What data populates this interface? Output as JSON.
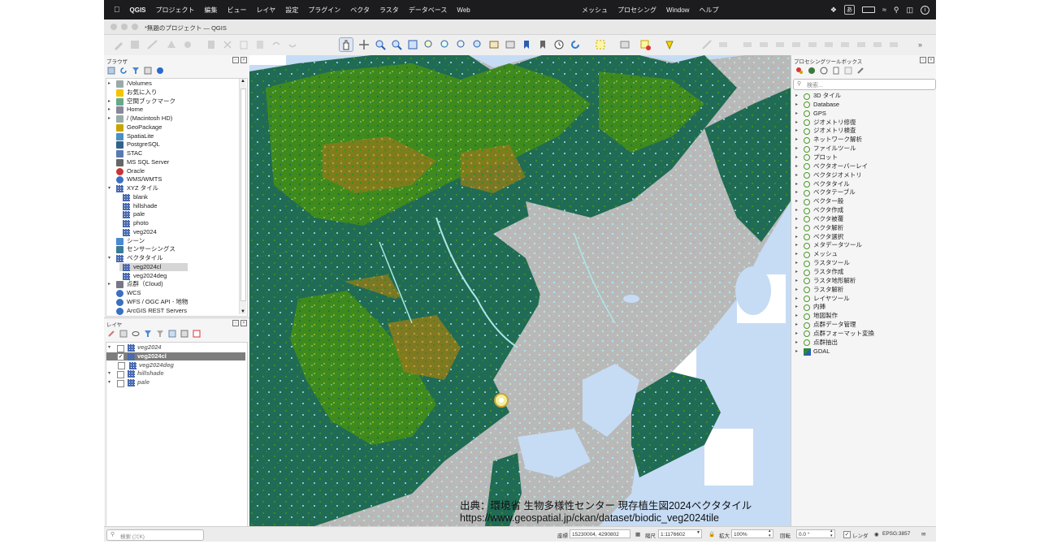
{
  "menubar": {
    "app_name": "QGIS",
    "items": [
      "プロジェクト",
      "編集",
      "ビュー",
      "レイヤ",
      "設定",
      "プラグイン",
      "ベクタ",
      "ラスタ",
      "データベース",
      "Web"
    ],
    "right_items": [
      "メッシュ",
      "プロセシング",
      "Window",
      "ヘルプ"
    ],
    "input_indicator": "あ"
  },
  "window": {
    "title": "*無題のプロジェクト — QGIS"
  },
  "browser": {
    "title": "ブラウザ",
    "items": [
      {
        "label": "/Volumes",
        "icon": "folder-icon",
        "level": 0,
        "arrow": "▸"
      },
      {
        "label": "お気に入り",
        "icon": "star-icon",
        "level": 0,
        "arrow": ""
      },
      {
        "label": "空間ブックマーク",
        "icon": "bookmark-icon",
        "level": 0,
        "arrow": "▸"
      },
      {
        "label": "Home",
        "icon": "home-icon",
        "level": 0,
        "arrow": "▸"
      },
      {
        "label": "/ (Macintosh HD)",
        "icon": "folder-icon",
        "level": 0,
        "arrow": "▸"
      },
      {
        "label": "GeoPackage",
        "icon": "geopackage-icon",
        "level": 0,
        "arrow": ""
      },
      {
        "label": "SpatiaLite",
        "icon": "spatialite-icon",
        "level": 0,
        "arrow": ""
      },
      {
        "label": "PostgreSQL",
        "icon": "postgresql-icon",
        "level": 0,
        "arrow": ""
      },
      {
        "label": "STAC",
        "icon": "stac-icon",
        "level": 0,
        "arrow": ""
      },
      {
        "label": "MS SQL Server",
        "icon": "mssql-icon",
        "level": 0,
        "arrow": ""
      },
      {
        "label": "Oracle",
        "icon": "oracle-icon",
        "level": 0,
        "arrow": ""
      },
      {
        "label": "WMS/WMTS",
        "icon": "globe-icon",
        "level": 0,
        "arrow": ""
      },
      {
        "label": "XYZ タイル",
        "icon": "grid-icon",
        "level": 0,
        "arrow": "▾"
      },
      {
        "label": "blank",
        "icon": "grid-icon",
        "level": 1,
        "arrow": ""
      },
      {
        "label": "hillshade",
        "icon": "grid-icon",
        "level": 1,
        "arrow": ""
      },
      {
        "label": "pale",
        "icon": "grid-icon",
        "level": 1,
        "arrow": ""
      },
      {
        "label": "photo",
        "icon": "grid-icon",
        "level": 1,
        "arrow": ""
      },
      {
        "label": "veg2024",
        "icon": "grid-icon",
        "level": 1,
        "arrow": ""
      },
      {
        "label": "シーン",
        "icon": "scene-icon",
        "level": 0,
        "arrow": ""
      },
      {
        "label": "センサーシングス",
        "icon": "sensor-icon",
        "level": 0,
        "arrow": ""
      },
      {
        "label": "ベクタタイル",
        "icon": "vector-tile-icon",
        "level": 0,
        "arrow": "▾"
      },
      {
        "label": "veg2024cl",
        "icon": "vector-tile-icon",
        "level": 1,
        "arrow": "",
        "selected": true
      },
      {
        "label": "veg2024deg",
        "icon": "vector-tile-icon",
        "level": 1,
        "arrow": ""
      },
      {
        "label": "点群（Cloud)",
        "icon": "cloud-icon",
        "level": 0,
        "arrow": "▸"
      },
      {
        "label": "WCS",
        "icon": "globe-icon",
        "level": 0,
        "arrow": ""
      },
      {
        "label": "WFS / OGC API - 地物",
        "icon": "globe-icon",
        "level": 0,
        "arrow": ""
      },
      {
        "label": "ArcGIS REST Servers",
        "icon": "globe-icon",
        "level": 0,
        "arrow": ""
      }
    ]
  },
  "layers": {
    "title": "レイヤ",
    "items": [
      {
        "label": "veg2024",
        "checked": false,
        "arrow": "▾",
        "level": 0,
        "selected": false
      },
      {
        "label": "veg2024cl",
        "checked": true,
        "arrow": "",
        "level": 0,
        "selected": true
      },
      {
        "label": "veg2024deg",
        "checked": false,
        "arrow": "",
        "level": 1,
        "selected": false
      },
      {
        "label": "hillshade",
        "checked": false,
        "arrow": "▾",
        "level": 0,
        "selected": false
      },
      {
        "label": "pale",
        "checked": false,
        "arrow": "▾",
        "level": 0,
        "selected": false
      }
    ]
  },
  "processing": {
    "title": "プロセシングツールボックス",
    "search_placeholder": "検索...",
    "items": [
      "3D タイル",
      "Database",
      "GPS",
      "ジオメトリ修復",
      "ジオメトリ検査",
      "ネットワーク解析",
      "ファイルツール",
      "プロット",
      "ベクタオーバーレイ",
      "ベクタジオメトリ",
      "ベクタタイル",
      "ベクタテーブル",
      "ベクター般",
      "ベクタ作成",
      "ベクタ被覆",
      "ベクタ解析",
      "ベクタ選択",
      "メタデータツール",
      "メッシュ",
      "ラスタツール",
      "ラスタ作成",
      "ラスタ地形解析",
      "ラスタ解析",
      "レイヤツール",
      "内挿",
      "地図製作",
      "点群データ管理",
      "点群フォーマット変換",
      "点群抽出",
      "GDAL"
    ]
  },
  "map": {
    "credit_line1": "出典：環境省 生物多様性センター 現存植生図2024ベクタタイル",
    "credit_line2": "https://www.geospatial.jp/ckan/dataset/biodic_veg2024tile"
  },
  "statusbar": {
    "search_placeholder": "検索 (⌘K)",
    "coord_label": "座標",
    "coord_value": "15230004, 4290802",
    "scale_label": "縮尺",
    "scale_value": "1:1176602",
    "magnifier_label": "拡大",
    "magnifier_value": "100%",
    "rotation_label": "回転",
    "rotation_value": "0.0 °",
    "render_label": "レンダ",
    "crs": "EPSG:3857"
  },
  "colors": {
    "forest_dark": "#1f6b55",
    "forest_green": "#3f8a1c",
    "farmland_olive": "#8a7a1c",
    "urban_gray": "#b9b9b9",
    "water_light": "#c6dcf5",
    "grass_cyan": "#aee6e6"
  }
}
